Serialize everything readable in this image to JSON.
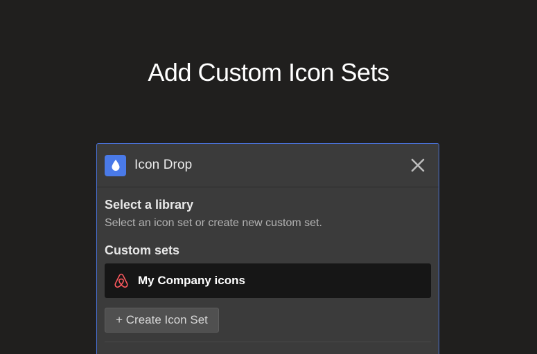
{
  "hero": {
    "title": "Add Custom Icon Sets"
  },
  "panel": {
    "app_name": "Icon Drop",
    "app_icon": "water-drop-icon",
    "close_icon": "close-icon",
    "library": {
      "title": "Select a library",
      "subtitle": "Select an icon set or create new custom set."
    },
    "custom_sets": {
      "title": "Custom sets",
      "items": [
        {
          "label": "My Company icons",
          "icon": "airbnb-logo-icon"
        }
      ]
    },
    "create_button_label": "+ Create Icon Set"
  },
  "colors": {
    "background": "#201f1e",
    "panel": "#3b3b3b",
    "panel_border": "#4a72d9",
    "accent": "#4a7ae8",
    "brand_logo": "#ff5a5f"
  }
}
